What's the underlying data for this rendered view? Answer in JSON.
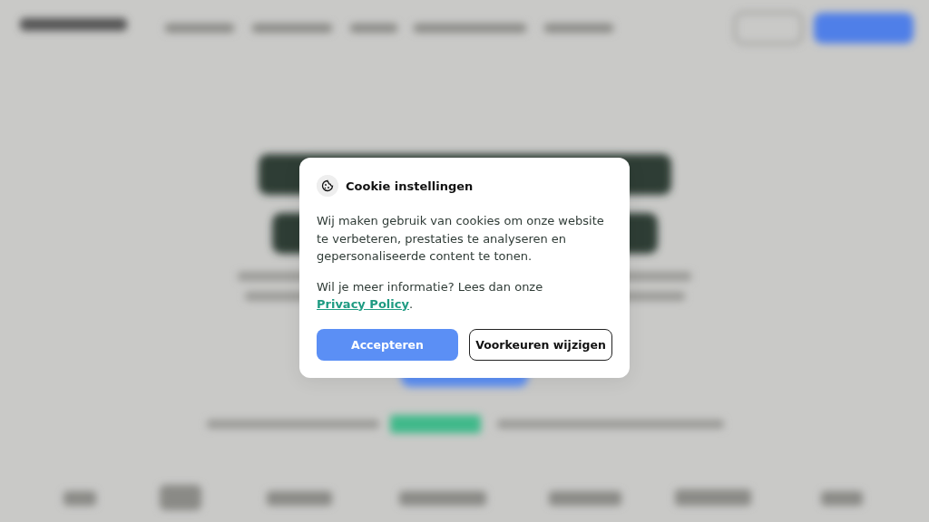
{
  "cookie_dialog": {
    "title": "Cookie instellingen",
    "body": "Wij maken gebruik van cookies om onze website te verbeteren, prestaties te analyseren en gepersonaliseerde content te tonen.",
    "info_text": "Wil je meer informatie? Lees dan onze ",
    "info_link": "Privacy Policy",
    "info_end": ".",
    "buttons": [
      {
        "label": "Accepteren",
        "kind": "primary"
      },
      {
        "label": "Voorkeuren wijzigen",
        "kind": "secondary"
      }
    ]
  }
}
